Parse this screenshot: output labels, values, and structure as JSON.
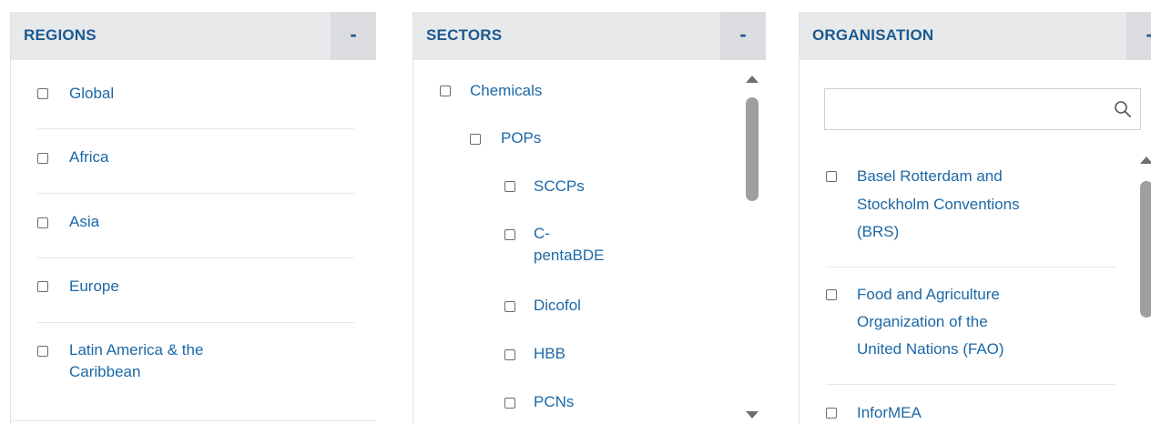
{
  "regions": {
    "title": "REGIONS",
    "collapse_label": "-",
    "items": [
      "Global",
      "Africa",
      "Asia",
      "Europe",
      "Latin America & the",
      "Caribbean"
    ]
  },
  "sectors": {
    "title": "SECTORS",
    "collapse_label": "-",
    "items": [
      "Chemicals",
      "POPs",
      "SCCPs",
      "C-",
      "pentaBDE",
      "Dicofol",
      "HBB",
      "PCNs"
    ]
  },
  "organisation": {
    "title": "ORGANISATION",
    "collapse_label": "-",
    "search": {
      "value": "",
      "placeholder": ""
    },
    "items": [
      "Basel Rotterdam and",
      "Stockholm Conventions",
      "(BRS)",
      "Food and Agriculture",
      "Organization of the",
      "United Nations (FAO)",
      "InforMEA"
    ]
  },
  "icons": {
    "checkbox": "checkbox-icon",
    "search": "search-icon",
    "scroll_up": "scroll-up-arrow-icon",
    "scroll_down": "scroll-down-arrow-icon"
  },
  "colors": {
    "header_bg": "#e8e9eb",
    "title": "#1b5a91",
    "link": "#1c68a6",
    "scroll_thumb": "#9f9f9f"
  }
}
